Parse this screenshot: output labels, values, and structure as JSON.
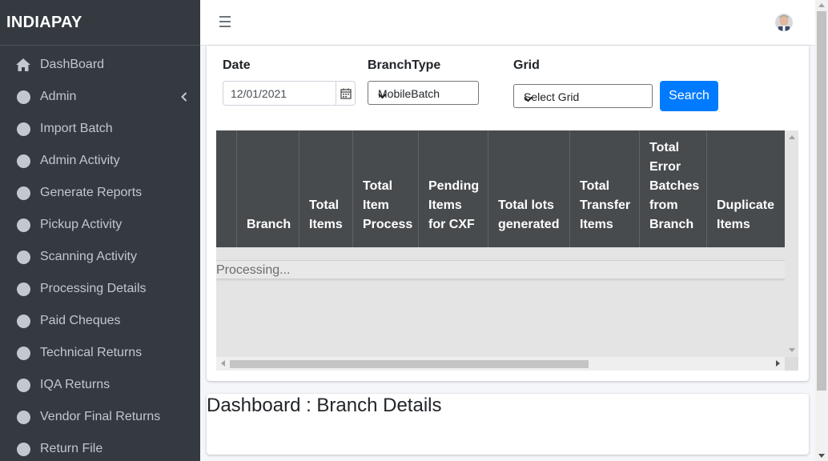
{
  "brand": "INDIAPAY",
  "sidebar": {
    "items": [
      {
        "label": "DashBoard",
        "icon": "home-icon"
      },
      {
        "label": "Admin",
        "icon": "circle-icon",
        "has_submenu": true
      },
      {
        "label": "Import Batch",
        "icon": "circle-icon"
      },
      {
        "label": "Admin Activity",
        "icon": "circle-icon"
      },
      {
        "label": "Generate Reports",
        "icon": "circle-icon"
      },
      {
        "label": "Pickup Activity",
        "icon": "circle-icon"
      },
      {
        "label": "Scanning Activity",
        "icon": "circle-icon"
      },
      {
        "label": "Processing Details",
        "icon": "circle-icon"
      },
      {
        "label": "Paid Cheques",
        "icon": "circle-icon"
      },
      {
        "label": "Technical Returns",
        "icon": "circle-icon"
      },
      {
        "label": "IQA Returns",
        "icon": "circle-icon"
      },
      {
        "label": "Vendor Final Returns",
        "icon": "circle-icon"
      },
      {
        "label": "Return File",
        "icon": "circle-icon"
      }
    ]
  },
  "filters": {
    "date_label": "Date",
    "date_value": "12/01/2021",
    "branch_type_label": "BranchType",
    "branch_type_value": "MobileBatch",
    "grid_label": "Grid",
    "grid_value": "Select Grid",
    "search_label": "Search"
  },
  "table": {
    "columns": [
      "",
      "Branch",
      "Total\nItems",
      "Total\nItem\nProcess",
      "Pending\nItems\nfor CXF",
      "Total lots\ngenerated",
      "Total\nTransfer\nItems",
      "Total\nError\nBatches\nfrom\nBranch",
      "Duplicate\nItems"
    ],
    "processing_text": "Processing..."
  },
  "dashboard": {
    "title": "Dashboard : Branch Details"
  },
  "colors": {
    "sidebar_bg": "#343a40",
    "primary": "#007bff",
    "table_header": "#484b4e"
  }
}
